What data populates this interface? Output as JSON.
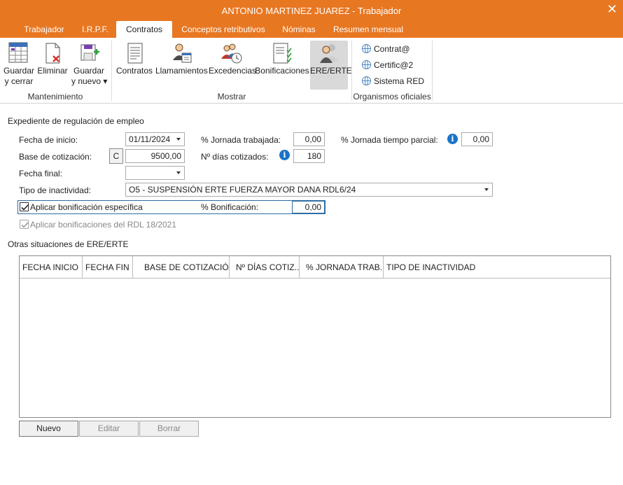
{
  "window": {
    "title": "ANTONIO MARTINEZ JUAREZ - Trabajador",
    "accent_color": "#e87722"
  },
  "tabs": [
    {
      "label": "Trabajador"
    },
    {
      "label": "I.R.P.F."
    },
    {
      "label": "Contratos"
    },
    {
      "label": "Conceptos retributivos"
    },
    {
      "label": "Nóminas"
    },
    {
      "label": "Resumen mensual"
    }
  ],
  "active_tab": "Contratos",
  "ribbon": {
    "mantenimiento": {
      "label": "Mantenimiento",
      "guardar_line1": "Guardar",
      "guardar_line2": "y cerrar",
      "eliminar": "Eliminar",
      "guardar_nuevo_line1": "Guardar",
      "guardar_nuevo_line2": "y nuevo ▾"
    },
    "mostrar": {
      "label": "Mostrar",
      "contratos": "Contratos",
      "llamamientos": "Llamamientos",
      "excedencias": "Excedencias",
      "bonificaciones": "Bonificaciones",
      "ere_erte": "ERE/ERTE"
    },
    "organismos": {
      "label": "Organismos oficiales",
      "contrata": "Contrat@",
      "certifica": "Certific@2",
      "sistema_red": "Sistema RED"
    }
  },
  "form": {
    "section_title": "Expediente de regulación de empleo",
    "fecha_inicio_label": "Fecha de inicio:",
    "fecha_inicio_value": "01/11/2024",
    "jornada_trabajada_label": "% Jornada trabajada:",
    "jornada_trabajada_value": "0,00",
    "jornada_parcial_label": "% Jornada tiempo parcial:",
    "jornada_parcial_value": "0,00",
    "base_cotizacion_label": "Base de cotización:",
    "base_cotizacion_button": "C",
    "base_cotizacion_value": "9500,00",
    "dias_cotizados_label": "Nº días cotizados:",
    "dias_cotizados_value": "180",
    "fecha_final_label": "Fecha final:",
    "fecha_final_value": "",
    "tipo_inactividad_label": "Tipo de inactividad:",
    "tipo_inactividad_value": "O5 - SUSPENSIÓN ERTE FUERZA MAYOR DANA RDL6/24",
    "aplicar_bonificacion_label": "Aplicar bonificación específica",
    "aplicar_bonificacion_checked": true,
    "porc_bonificacion_label": "% Bonificación:",
    "porc_bonificacion_value": "0,00",
    "aplicar_rdl_label": "Aplicar bonificaciones del RDL 18/2021",
    "aplicar_rdl_checked": true,
    "info_icon_glyph": "i"
  },
  "otras": {
    "section_title": "Otras situaciones de ERE/ERTE",
    "columns": [
      "FECHA INICIO",
      "FECHA FIN",
      "BASE DE COTIZACIÓN",
      "Nº DÍAS COTIZ...",
      "% JORNADA TRAB...",
      "TIPO DE INACTIVIDAD"
    ],
    "rows": [],
    "buttons": {
      "nuevo": "Nuevo",
      "editar": "Editar",
      "borrar": "Borrar"
    }
  }
}
